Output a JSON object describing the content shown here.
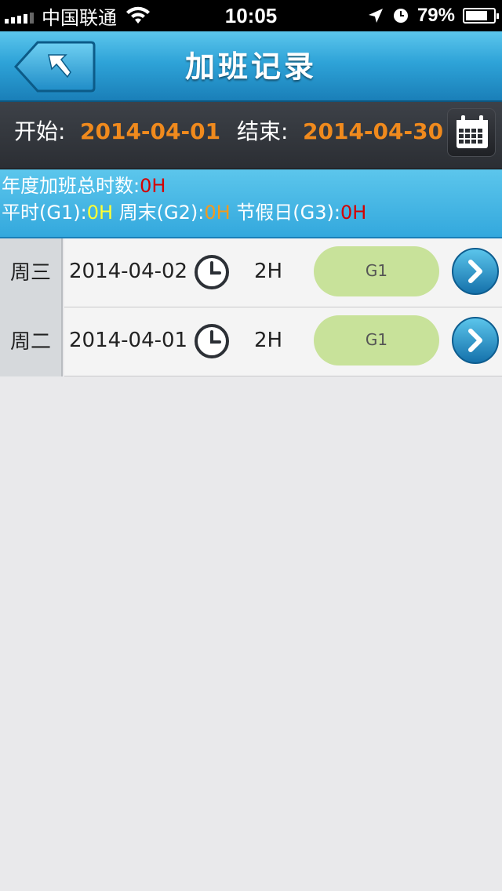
{
  "status_bar": {
    "carrier": "中国联通",
    "time": "10:05",
    "battery_percent": "79%",
    "battery_level": 0.79,
    "icons": [
      "signal-icon",
      "wifi-icon",
      "location-arrow-icon",
      "alarm-clock-icon",
      "battery-icon"
    ]
  },
  "navbar": {
    "title": "加班记录",
    "back_icon": "back-arrow-icon"
  },
  "date_range": {
    "start_label": "开始:",
    "start_value": "2014-04-01",
    "end_label": "结束:",
    "end_value": "2014-04-30",
    "calendar_icon": "calendar-icon"
  },
  "summary": {
    "annual_label": "年度加班总时数:",
    "annual_value": "0H",
    "g1_label": "平时(G1):",
    "g1_value": "0H",
    "g2_label": "周末(G2):",
    "g2_value": "0H",
    "g3_label": "节假日(G3):",
    "g3_value": "0H"
  },
  "records": [
    {
      "weekday": "周三",
      "date": "2014-04-02",
      "hours": "2H",
      "type": "G1"
    },
    {
      "weekday": "周二",
      "date": "2014-04-01",
      "hours": "2H",
      "type": "G1"
    }
  ],
  "colors": {
    "accent_blue": "#2ea3d8",
    "date_orange": "#f08a1d",
    "pill_green": "#c8e29a",
    "value_red": "#d40000",
    "value_yellow": "#ffff33",
    "value_orange": "#f39a1e"
  }
}
